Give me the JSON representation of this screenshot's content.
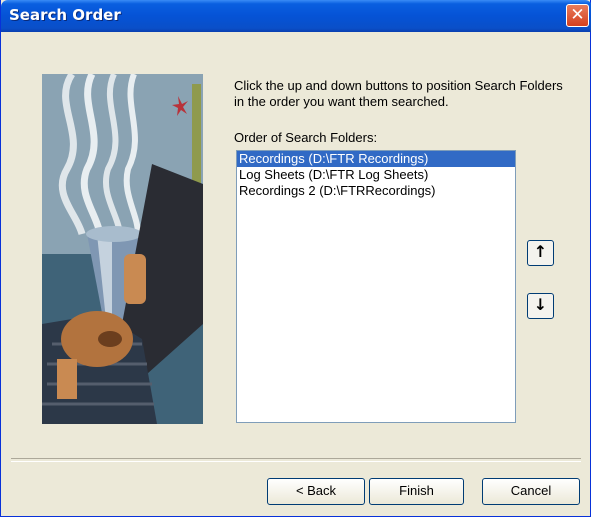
{
  "window": {
    "title": "Search Order",
    "close_glyph": "✕"
  },
  "main": {
    "instructions": "Click the up and down buttons to position Search Folders in the order you want them searched.",
    "list_label": "Order of Search Folders:",
    "folders": [
      {
        "label": "Recordings  (D:\\FTR Recordings)",
        "selected": true
      },
      {
        "label": "Log Sheets  (D:\\FTR Log Sheets)",
        "selected": false
      },
      {
        "label": "Recordings 2  (D:\\FTRRecordings)",
        "selected": false
      }
    ],
    "move_up_glyph": "↑",
    "move_down_glyph": "↓"
  },
  "footer": {
    "back_label": "< Back",
    "finish_label": "Finish",
    "cancel_label": "Cancel"
  },
  "colors": {
    "titlebar": "#0553d6",
    "close": "#d4401f",
    "selection": "#316ac5",
    "dialog_bg": "#ece9d8"
  },
  "icons": {
    "close": "close-icon",
    "up": "arrow-up-icon",
    "down": "arrow-down-icon"
  }
}
